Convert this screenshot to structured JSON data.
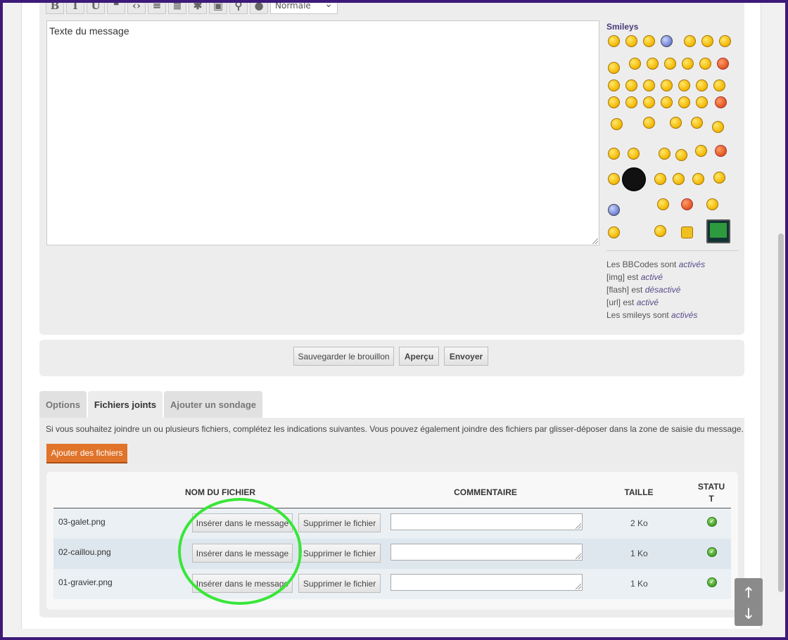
{
  "toolbar": {
    "buttons": [
      "bold-icon",
      "italic-icon",
      "underline-icon",
      "quote-icon",
      "code-icon",
      "list-icon",
      "numbered-list-icon",
      "star-icon",
      "image-icon",
      "link-icon",
      "flash-icon"
    ],
    "font_size_value": "Normale"
  },
  "editor": {
    "message_text": "Texte du message"
  },
  "smileys": {
    "title": "Smileys"
  },
  "bbcode_info": {
    "line1_prefix": "Les BBCodes sont ",
    "line1_value": "activés",
    "line2_prefix": "[img] est ",
    "line2_value": "activé",
    "line3_prefix": "[flash] est ",
    "line3_value": "désactivé",
    "line4_prefix": "[url] est ",
    "line4_value": "activé",
    "line5_prefix": "Les smileys sont ",
    "line5_value": "activés"
  },
  "actions": {
    "save_draft": "Sauvegarder le brouillon",
    "preview": "Aperçu",
    "send": "Envoyer"
  },
  "tabs": {
    "options": "Options",
    "attachments": "Fichiers joints",
    "poll": "Ajouter un sondage"
  },
  "attachments": {
    "help": "Si vous souhaitez joindre un ou plusieurs fichiers, complétez les indications suivantes. Vous pouvez également joindre des fichiers par glisser-déposer dans la zone de saisie du message.",
    "add_files": "Ajouter des fichiers",
    "headers": {
      "filename": "NOM DU FICHIER",
      "comment": "COMMENTAIRE",
      "size": "TAILLE",
      "status_1": "STATU",
      "status_2": "T"
    },
    "insert_label": "Insérer dans le message",
    "delete_label": "Supprimer le fichier",
    "files": [
      {
        "name": "03-galet.png",
        "size": "2 Ko",
        "comment": ""
      },
      {
        "name": "02-caillou.png",
        "size": "1 Ko",
        "comment": ""
      },
      {
        "name": "01-gravier.png",
        "size": "1 Ko",
        "comment": ""
      }
    ]
  },
  "colors": {
    "frame": "#3d1a7a",
    "accent_orange": "#e0742a",
    "highlight": "#39e639",
    "status_ok": "#3e9c27"
  },
  "scroll_nav": {
    "up_icon": "arrow-up-icon",
    "down_icon": "arrow-down-icon"
  }
}
